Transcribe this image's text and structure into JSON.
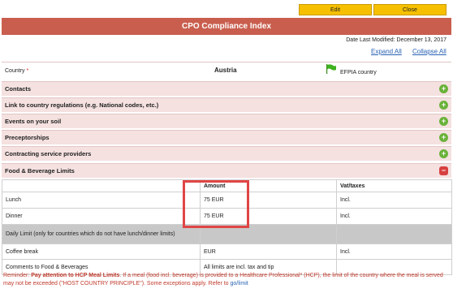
{
  "toolbar": {
    "edit_label": "Edit",
    "close_label": "Close"
  },
  "title": "CPO Compliance Index",
  "date_modified": "Date Last Modified: December 13, 2017",
  "links": {
    "expand_all": "Expand All",
    "collapse_all": "Collapse All"
  },
  "country": {
    "label": "Country",
    "required_mark": "*",
    "value": "Austria",
    "efpia": "EFPIA country"
  },
  "sections": [
    {
      "label": "Contacts",
      "state": "collapsed"
    },
    {
      "label": "Link to country regulations (e.g. National codes, etc.)",
      "state": "collapsed"
    },
    {
      "label": "Events on your soil",
      "state": "collapsed"
    },
    {
      "label": "Preceptorships",
      "state": "collapsed"
    },
    {
      "label": "Contracting service providers",
      "state": "collapsed"
    },
    {
      "label": "Food & Beverage Limits",
      "state": "expanded"
    }
  ],
  "fb_table": {
    "headers": {
      "amount": "Amount",
      "vat": "Vat/taxes"
    },
    "rows": [
      {
        "label": "Lunch",
        "amount": "75 EUR",
        "vat": "Incl."
      },
      {
        "label": "Dinner",
        "amount": "75 EUR",
        "vat": "Incl."
      }
    ],
    "daily_limit": "Daily Limit  (only for countries which do not have lunch/dinner limits)",
    "coffee": {
      "label": "Coffee break",
      "amount": "EUR",
      "vat": "Incl."
    },
    "comments": {
      "label": "Comments to Food & Beverages",
      "value": "All limits are incl. tax and tip"
    }
  },
  "reminder": {
    "prefix": "Reminder: ",
    "bold": "Pay attention to HCP Meal Limits",
    "text": ". If a meal (food incl. beverage) is provided to a Healthcare Professional* (HCP), the limit of the country where the meal is served may not be exceeded (\"HOST COUNTRY PRINCIPLE\"). Some exceptions apply. Refer to ",
    "link": "go/limit"
  },
  "colors": {
    "header": "#c95e4e",
    "section_bg": "#f4e1e0",
    "button": "#f6c000",
    "highlight": "#e04545"
  }
}
